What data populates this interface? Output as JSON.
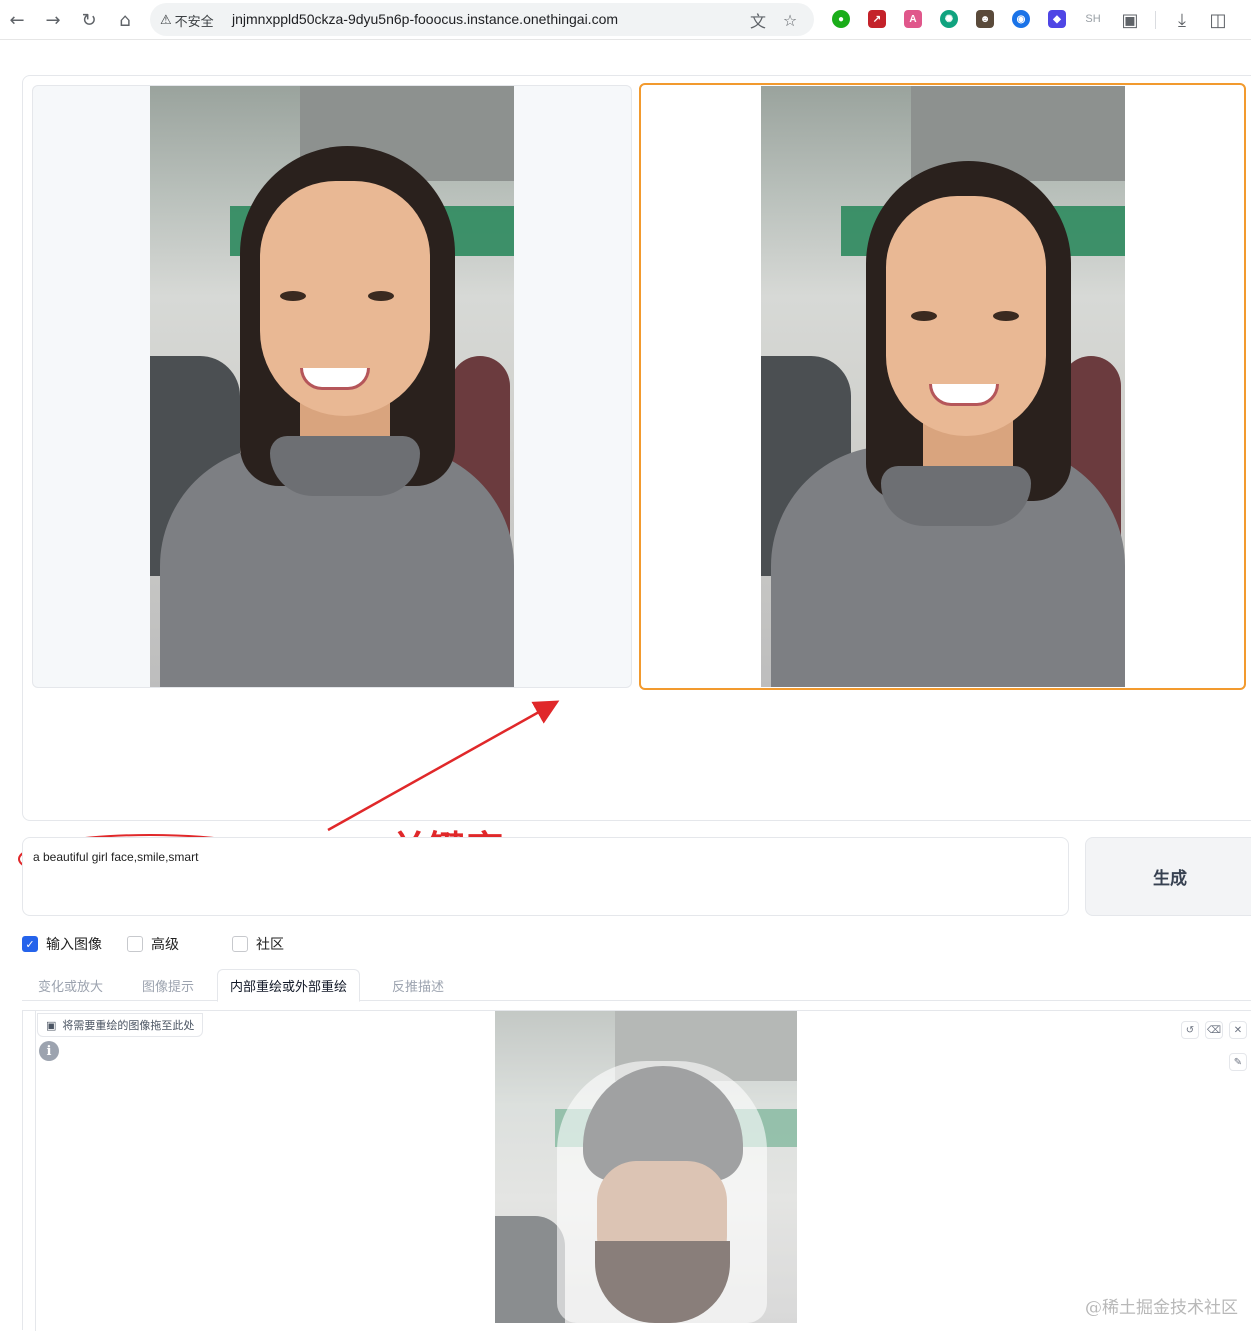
{
  "browser": {
    "security_label": "不安全",
    "url": "jnjmnxppld50ckza-9dyu5n6p-fooocus.instance.onethingai.com",
    "extension_sh_label": "SH"
  },
  "annotation": {
    "label": "关键字",
    "color": "#e0282a"
  },
  "prompt": {
    "value": "a beautiful girl face,smile,smart"
  },
  "generate": {
    "label": "生成"
  },
  "options": [
    {
      "label": "输入图像",
      "checked": true
    },
    {
      "label": "高级",
      "checked": false
    },
    {
      "label": "社区",
      "checked": false
    }
  ],
  "tabs": [
    {
      "label": "变化或放大",
      "active": false
    },
    {
      "label": "图像提示",
      "active": false
    },
    {
      "label": "内部重绘或外部重绘",
      "active": true
    },
    {
      "label": "反推描述",
      "active": false
    }
  ],
  "inpaint": {
    "drop_label": "将需要重绘的图像拖至此处"
  },
  "watermark": "@稀土掘金技术社区",
  "colors": {
    "selected_border": "#f29a2e",
    "checkbox_accent": "#2563eb"
  }
}
